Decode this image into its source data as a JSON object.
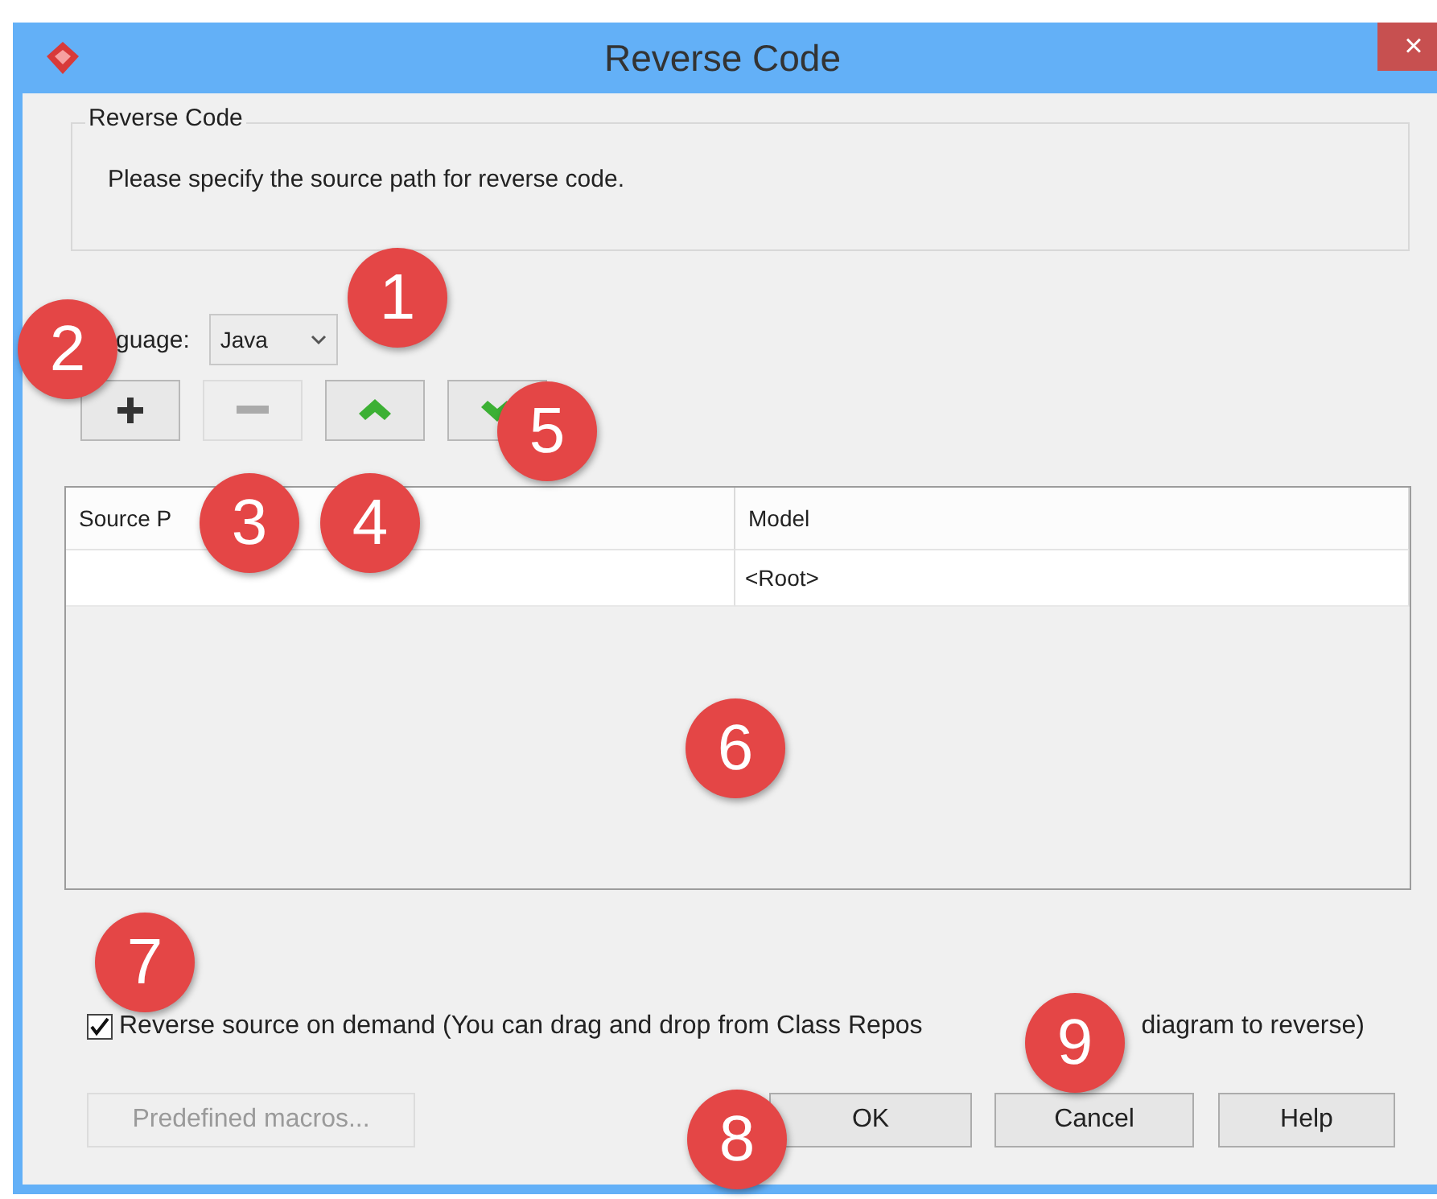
{
  "window": {
    "title": "Reverse Code",
    "close": "×"
  },
  "group": {
    "legend": "Reverse Code",
    "text": "Please specify the source path for reverse code."
  },
  "language": {
    "label": "guage:",
    "value": "Java"
  },
  "toolbar": [
    {
      "kind": "add",
      "disabled": false
    },
    {
      "kind": "remove",
      "disabled": true
    },
    {
      "kind": "up",
      "disabled": false
    },
    {
      "kind": "down",
      "disabled": false
    }
  ],
  "table": {
    "columns": [
      "Source P",
      "Model"
    ],
    "rows": [
      [
        "",
        "<Root>"
      ]
    ]
  },
  "reverse_on_demand": {
    "checked": true,
    "text_before": "Reverse source on demand (You can drag and drop from Class Repos",
    "text_after": "diagram to reverse)"
  },
  "buttons": [
    {
      "label": "Predefined macros...",
      "disabled": true
    },
    {
      "label": "OK",
      "disabled": false
    },
    {
      "label": "Cancel",
      "disabled": false
    },
    {
      "label": "Help",
      "disabled": false
    }
  ],
  "callouts": [
    "1",
    "2",
    "3",
    "4",
    "5",
    "6",
    "7",
    "8",
    "9"
  ]
}
